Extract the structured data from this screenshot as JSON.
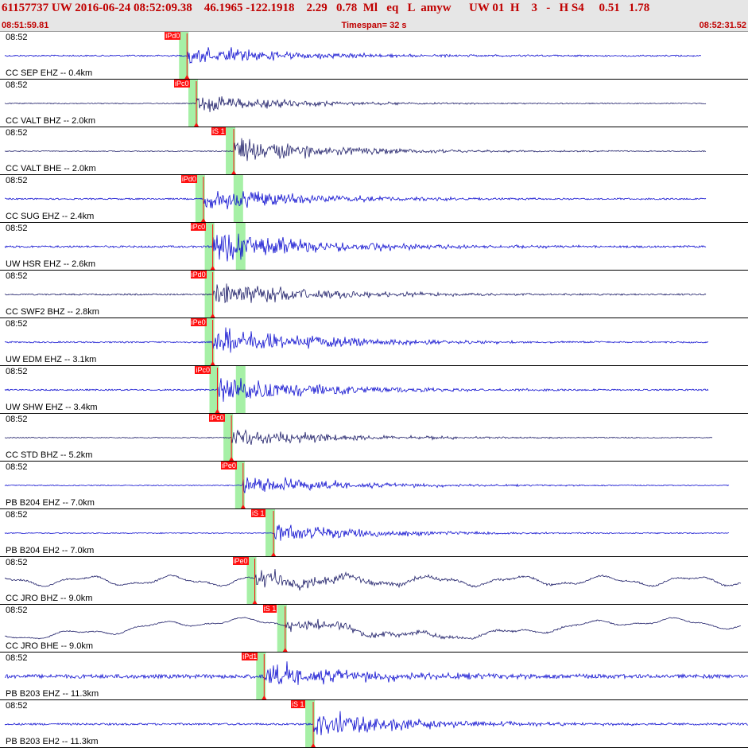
{
  "header": {
    "title": "61157737 UW 2016-06-24 08:52:09.38    46.1965 -122.1918    2.29   0.78  Ml   eq   L  amyw      UW 01  H    3   -   H S4     0.51   1.78",
    "time_start": "08:51:59.81",
    "timespan": "Timespan=  32 s",
    "time_end": "08:52:31.52"
  },
  "colors": {
    "header_text": "#c00000",
    "header_bg": "#e6e6e6",
    "trace_blue": "#1010d0",
    "trace_dark": "#20206a",
    "pick": "#ff1010",
    "window_green": "#a6f0a6"
  },
  "panels": [
    {
      "time": "08:52",
      "label": "CC SEP EHZ -- 0.4km",
      "color": "blue",
      "pick": "iPd0",
      "pick_s": 8.0,
      "s_pick": null,
      "amp": 0.28,
      "noise": 0.03,
      "lf": 0,
      "drift": 0,
      "end_s": 30.0
    },
    {
      "time": "08:52",
      "label": "CC VALT BHZ -- 2.0km",
      "color": "dark",
      "pick": "iPc0",
      "pick_s": 8.4,
      "s_pick": null,
      "amp": 0.22,
      "noise": 0.02,
      "lf": 0,
      "drift": 0,
      "end_s": 30.2
    },
    {
      "time": "08:52",
      "label": "CC VALT BHE -- 2.0km",
      "color": "dark",
      "pick": "iS 1",
      "pick_s": 10.0,
      "s_pick": 10.0,
      "amp": 0.33,
      "noise": 0.02,
      "lf": 0,
      "drift": 0,
      "end_s": 30.2
    },
    {
      "time": "08:52",
      "label": "CC SUG EHZ -- 2.4km",
      "color": "blue",
      "pick": "iPd0",
      "pick_s": 8.7,
      "s_pick": 10.4,
      "amp": 0.34,
      "noise": 0.03,
      "lf": 0,
      "drift": 0,
      "end_s": 30.2
    },
    {
      "time": "08:52",
      "label": "UW HSR EHZ -- 2.6km",
      "color": "blue",
      "pick": "iPc0",
      "pick_s": 9.1,
      "s_pick": 10.5,
      "amp": 0.44,
      "noise": 0.04,
      "lf": 0,
      "drift": 0,
      "end_s": 30.2
    },
    {
      "time": "08:52",
      "label": "CC SWF2 BHZ -- 2.8km",
      "color": "dark",
      "pick": "iPd0",
      "pick_s": 9.1,
      "s_pick": null,
      "amp": 0.36,
      "noise": 0.03,
      "lf": 0,
      "drift": 0,
      "end_s": 30.2
    },
    {
      "time": "08:52",
      "label": "UW EDM EHZ -- 3.1km",
      "color": "blue",
      "pick": "iPe0",
      "pick_s": 9.1,
      "s_pick": null,
      "amp": 0.44,
      "noise": 0.03,
      "lf": 0,
      "drift": 0,
      "end_s": 30.3
    },
    {
      "time": "08:52",
      "label": "UW SHW EHZ -- 3.4km",
      "color": "blue",
      "pick": "iPc0",
      "pick_s": 9.3,
      "s_pick": 10.5,
      "amp": 0.38,
      "noise": 0.03,
      "lf": 0,
      "drift": 0,
      "end_s": 30.3
    },
    {
      "time": "08:52",
      "label": "CC STD BHZ -- 5.2km",
      "color": "dark",
      "pick": "iPc0",
      "pick_s": 9.9,
      "s_pick": null,
      "amp": 0.25,
      "noise": 0.02,
      "lf": 0,
      "drift": 0,
      "end_s": 30.5
    },
    {
      "time": "08:52",
      "label": "PB B204 EHZ -- 7.0km",
      "color": "blue",
      "pick": "iPe0",
      "pick_s": 10.4,
      "s_pick": null,
      "amp": 0.26,
      "noise": 0.02,
      "lf": 0,
      "drift": 0,
      "end_s": 31.2
    },
    {
      "time": "08:52",
      "label": "PB B204 EH2 -- 7.0km",
      "color": "blue",
      "pick": "iS 1",
      "pick_s": 11.7,
      "s_pick": 11.7,
      "amp": 0.24,
      "noise": 0.02,
      "lf": 0,
      "drift": 0,
      "end_s": 31.2
    },
    {
      "time": "08:52",
      "label": "CC JRO BHZ -- 9.0km",
      "color": "dark",
      "pick": "iPe0",
      "pick_s": 10.9,
      "s_pick": null,
      "amp": 0.25,
      "noise": 0.03,
      "lf": 0.16,
      "drift": 0,
      "end_s": 31.7
    },
    {
      "time": "08:52",
      "label": "CC JRO BHE -- 9.0km",
      "color": "dark",
      "pick": "iS 1",
      "pick_s": 12.2,
      "s_pick": 12.2,
      "amp": 0.22,
      "noise": 0.02,
      "lf": 0.12,
      "drift": 0.3,
      "end_s": 31.7
    },
    {
      "time": "08:52",
      "label": "PB B203 EHZ -- 11.3km",
      "color": "blue",
      "pick": "iPd1",
      "pick_s": 11.3,
      "s_pick": null,
      "amp": 0.36,
      "noise": 0.08,
      "lf": 0,
      "drift": 0,
      "end_s": 32.0
    },
    {
      "time": "08:52",
      "label": "PB B203 EH2 -- 11.3km",
      "color": "blue",
      "pick": "iS 1",
      "pick_s": 13.4,
      "s_pick": 13.4,
      "amp": 0.36,
      "noise": 0.04,
      "lf": 0,
      "drift": 0,
      "end_s": 32.0
    }
  ]
}
